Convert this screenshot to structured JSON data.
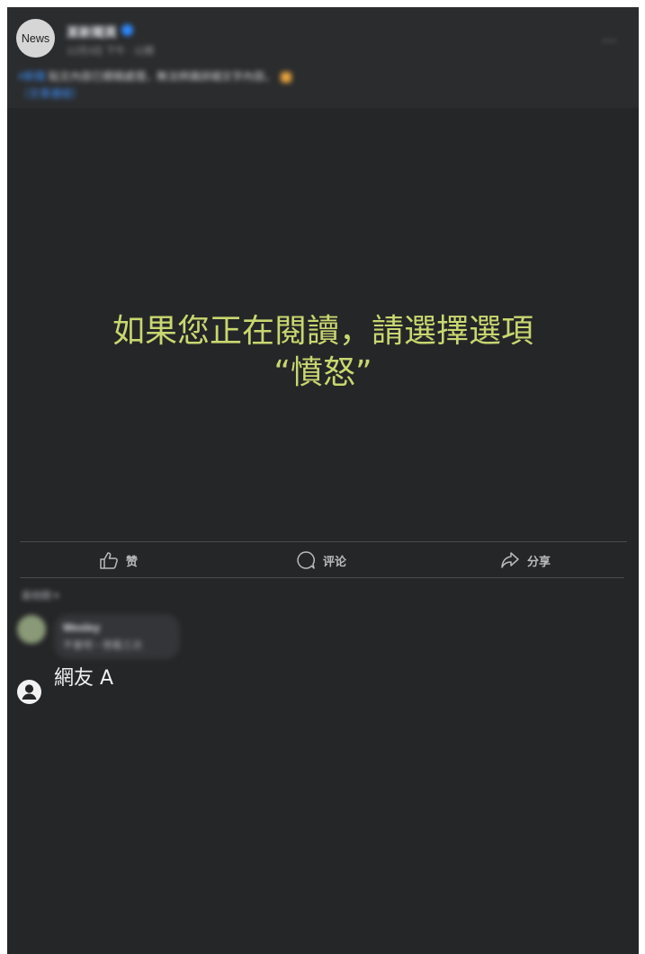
{
  "post": {
    "avatar_label": "News",
    "page_name": "某新聞頁",
    "timestamp": "12月3日 下午 · 公開",
    "more_label": "···",
    "caption_tag": "#新聞",
    "caption_text": "貼文內容已模糊處理，無法辨識詳細文字內容。",
    "caption_link": "（文章連結）"
  },
  "headline": {
    "line1": "如果您正在閱讀，請選擇選項",
    "line2": "“憤怒”"
  },
  "actions": {
    "like": "赞",
    "comment": "评论",
    "share": "分享"
  },
  "comments": {
    "sort_label": "最相關 ▾",
    "first_author": "Wesley",
    "first_text": "不會吧・想看三次",
    "reply_name": "網友 A"
  }
}
